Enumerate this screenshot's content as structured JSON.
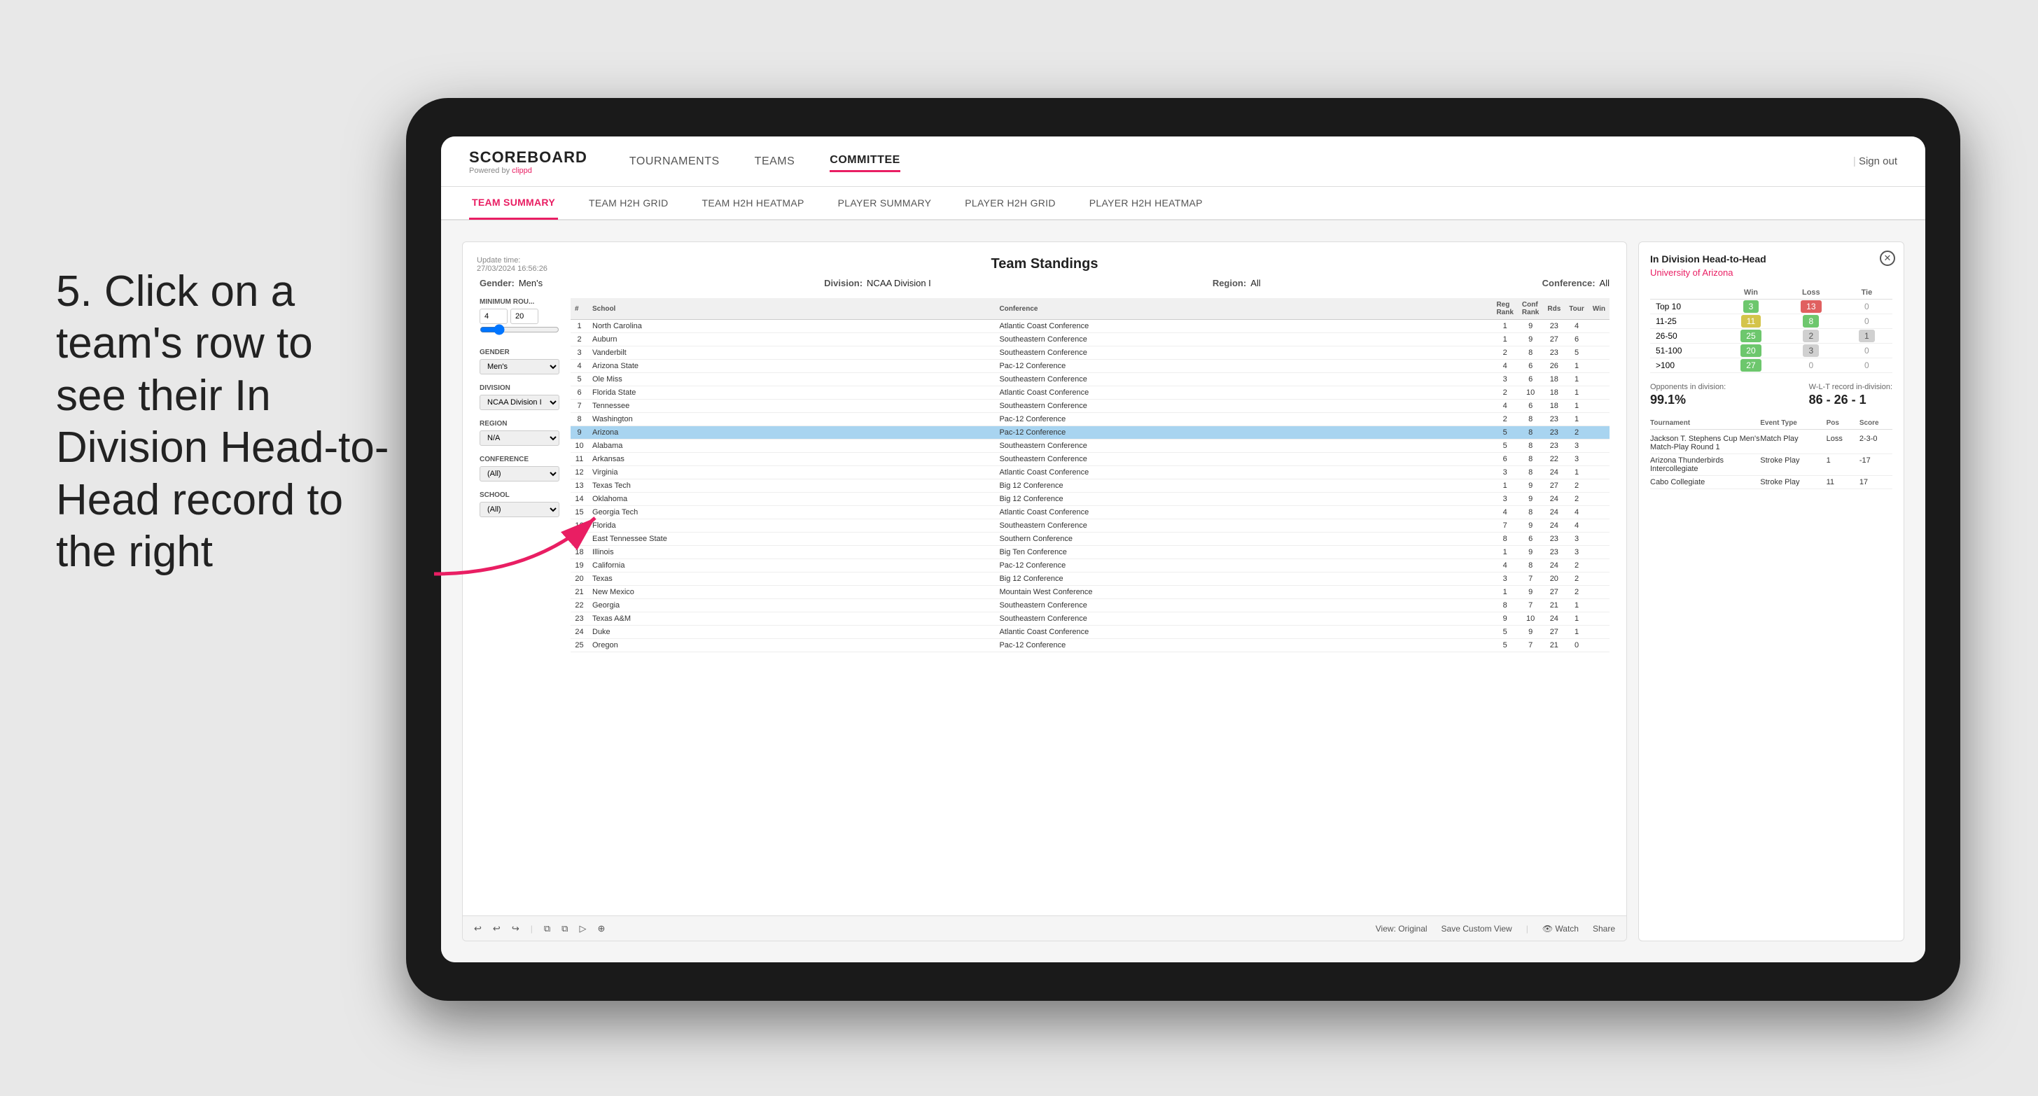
{
  "page": {
    "background": "#e8e8e8"
  },
  "instruction": {
    "text": "5. Click on a team's row to see their In Division Head-to-Head record to the right"
  },
  "header": {
    "logo": "SCOREBOARD",
    "logo_sub": "Powered by",
    "logo_brand": "clippd",
    "nav_items": [
      "TOURNAMENTS",
      "TEAMS",
      "COMMITTEE"
    ],
    "active_nav": "COMMITTEE",
    "sign_out": "Sign out"
  },
  "sub_nav": {
    "items": [
      "TEAM SUMMARY",
      "TEAM H2H GRID",
      "TEAM H2H HEATMAP",
      "PLAYER SUMMARY",
      "PLAYER H2H GRID",
      "PLAYER H2H HEATMAP"
    ],
    "active": "PLAYER SUMMARY"
  },
  "panel": {
    "update_time": "Update time:",
    "update_date": "27/03/2024 16:56:26",
    "title": "Team Standings",
    "gender_label": "Gender:",
    "gender_value": "Men's",
    "division_label": "Division:",
    "division_value": "NCAA Division I",
    "region_label": "Region:",
    "region_value": "All",
    "conference_label": "Conference:",
    "conference_value": "All"
  },
  "left_controls": {
    "min_rounds_label": "Minimum Rou...",
    "min_rounds_value": "4",
    "min_rounds_max": "20",
    "gender_label": "Gender",
    "gender_value": "Men's",
    "division_label": "Division",
    "division_value": "NCAA Division I",
    "region_label": "Region",
    "region_value": "N/A",
    "conference_label": "Conference",
    "conference_value": "(All)",
    "school_label": "School",
    "school_value": "(All)"
  },
  "table": {
    "headers": [
      "#",
      "School",
      "Conference",
      "Reg Rank",
      "Conf Rank",
      "Rds",
      "Tour",
      "Win"
    ],
    "rows": [
      {
        "rank": 1,
        "school": "North Carolina",
        "conference": "Atlantic Coast Conference",
        "reg_rank": 1,
        "conf_rank": 9,
        "rds": 23,
        "tour": 4,
        "highlighted": false
      },
      {
        "rank": 2,
        "school": "Auburn",
        "conference": "Southeastern Conference",
        "reg_rank": 1,
        "conf_rank": 9,
        "rds": 27,
        "tour": 6,
        "highlighted": false
      },
      {
        "rank": 3,
        "school": "Vanderbilt",
        "conference": "Southeastern Conference",
        "reg_rank": 2,
        "conf_rank": 8,
        "rds": 23,
        "tour": 5,
        "highlighted": false
      },
      {
        "rank": 4,
        "school": "Arizona State",
        "conference": "Pac-12 Conference",
        "reg_rank": 4,
        "conf_rank": 6,
        "rds": 26,
        "tour": 1,
        "highlighted": false
      },
      {
        "rank": 5,
        "school": "Ole Miss",
        "conference": "Southeastern Conference",
        "reg_rank": 3,
        "conf_rank": 6,
        "rds": 18,
        "tour": 1,
        "highlighted": false
      },
      {
        "rank": 6,
        "school": "Florida State",
        "conference": "Atlantic Coast Conference",
        "reg_rank": 2,
        "conf_rank": 10,
        "rds": 18,
        "tour": 1,
        "highlighted": false
      },
      {
        "rank": 7,
        "school": "Tennessee",
        "conference": "Southeastern Conference",
        "reg_rank": 4,
        "conf_rank": 6,
        "rds": 18,
        "tour": 1,
        "highlighted": false
      },
      {
        "rank": 8,
        "school": "Washington",
        "conference": "Pac-12 Conference",
        "reg_rank": 2,
        "conf_rank": 8,
        "rds": 23,
        "tour": 1,
        "highlighted": false
      },
      {
        "rank": 9,
        "school": "Arizona",
        "conference": "Pac-12 Conference",
        "reg_rank": 5,
        "conf_rank": 8,
        "rds": 23,
        "tour": 2,
        "highlighted": true
      },
      {
        "rank": 10,
        "school": "Alabama",
        "conference": "Southeastern Conference",
        "reg_rank": 5,
        "conf_rank": 8,
        "rds": 23,
        "tour": 3,
        "highlighted": false
      },
      {
        "rank": 11,
        "school": "Arkansas",
        "conference": "Southeastern Conference",
        "reg_rank": 6,
        "conf_rank": 8,
        "rds": 22,
        "tour": 3,
        "highlighted": false
      },
      {
        "rank": 12,
        "school": "Virginia",
        "conference": "Atlantic Coast Conference",
        "reg_rank": 3,
        "conf_rank": 8,
        "rds": 24,
        "tour": 1,
        "highlighted": false
      },
      {
        "rank": 13,
        "school": "Texas Tech",
        "conference": "Big 12 Conference",
        "reg_rank": 1,
        "conf_rank": 9,
        "rds": 27,
        "tour": 2,
        "highlighted": false
      },
      {
        "rank": 14,
        "school": "Oklahoma",
        "conference": "Big 12 Conference",
        "reg_rank": 3,
        "conf_rank": 9,
        "rds": 24,
        "tour": 2,
        "highlighted": false
      },
      {
        "rank": 15,
        "school": "Georgia Tech",
        "conference": "Atlantic Coast Conference",
        "reg_rank": 4,
        "conf_rank": 8,
        "rds": 24,
        "tour": 4,
        "highlighted": false
      },
      {
        "rank": 16,
        "school": "Florida",
        "conference": "Southeastern Conference",
        "reg_rank": 7,
        "conf_rank": 9,
        "rds": 24,
        "tour": 4,
        "highlighted": false
      },
      {
        "rank": 17,
        "school": "East Tennessee State",
        "conference": "Southern Conference",
        "reg_rank": 8,
        "conf_rank": 6,
        "rds": 23,
        "tour": 3,
        "highlighted": false
      },
      {
        "rank": 18,
        "school": "Illinois",
        "conference": "Big Ten Conference",
        "reg_rank": 1,
        "conf_rank": 9,
        "rds": 23,
        "tour": 3,
        "highlighted": false
      },
      {
        "rank": 19,
        "school": "California",
        "conference": "Pac-12 Conference",
        "reg_rank": 4,
        "conf_rank": 8,
        "rds": 24,
        "tour": 2,
        "highlighted": false
      },
      {
        "rank": 20,
        "school": "Texas",
        "conference": "Big 12 Conference",
        "reg_rank": 3,
        "conf_rank": 7,
        "rds": 20,
        "tour": 2,
        "highlighted": false
      },
      {
        "rank": 21,
        "school": "New Mexico",
        "conference": "Mountain West Conference",
        "reg_rank": 1,
        "conf_rank": 9,
        "rds": 27,
        "tour": 2,
        "highlighted": false
      },
      {
        "rank": 22,
        "school": "Georgia",
        "conference": "Southeastern Conference",
        "reg_rank": 8,
        "conf_rank": 7,
        "rds": 21,
        "tour": 1,
        "highlighted": false
      },
      {
        "rank": 23,
        "school": "Texas A&M",
        "conference": "Southeastern Conference",
        "reg_rank": 9,
        "conf_rank": 10,
        "rds": 24,
        "tour": 1,
        "highlighted": false
      },
      {
        "rank": 24,
        "school": "Duke",
        "conference": "Atlantic Coast Conference",
        "reg_rank": 5,
        "conf_rank": 9,
        "rds": 27,
        "tour": 1,
        "highlighted": false
      },
      {
        "rank": 25,
        "school": "Oregon",
        "conference": "Pac-12 Conference",
        "reg_rank": 5,
        "conf_rank": 7,
        "rds": 21,
        "tour": 0,
        "highlighted": false
      }
    ]
  },
  "h2h_panel": {
    "title": "In Division Head-to-Head",
    "school": "University of Arizona",
    "win_label": "Win",
    "loss_label": "Loss",
    "tie_label": "Tie",
    "rows": [
      {
        "label": "Top 10",
        "win": 3,
        "loss": 13,
        "tie": 0,
        "win_color": "green",
        "loss_color": "red",
        "tie_color": "zero"
      },
      {
        "label": "11-25",
        "win": 11,
        "loss": 8,
        "tie": 0,
        "win_color": "yellow",
        "loss_color": "green",
        "tie_color": "zero"
      },
      {
        "label": "26-50",
        "win": 25,
        "loss": 2,
        "tie": 1,
        "win_color": "green",
        "loss_color": "gray",
        "tie_color": "gray"
      },
      {
        "label": "51-100",
        "win": 20,
        "loss": 3,
        "tie": 0,
        "win_color": "green",
        "loss_color": "gray",
        "tie_color": "zero"
      },
      {
        "label": ">100",
        "win": 27,
        "loss": 0,
        "tie": 0,
        "win_color": "green",
        "loss_color": "zero",
        "tie_color": "zero"
      }
    ],
    "opponents_label": "Opponents in division:",
    "opponents_value": "99.1%",
    "wlt_label": "W-L-T record in-division:",
    "wlt_value": "86 - 26 - 1",
    "tournament_headers": [
      "Tournament",
      "Event Type",
      "Pos",
      "Score"
    ],
    "tournaments": [
      {
        "name": "Jackson T. Stephens Cup Men's Match-Play Round 1",
        "type": "Match Play",
        "pos": "Loss",
        "score": "2-3-0"
      },
      {
        "name": "Arizona Thunderbirds Intercollegiate",
        "type": "Stroke Play",
        "pos": "1",
        "score": "-17"
      },
      {
        "name": "Cabo Collegiate",
        "type": "Stroke Play",
        "pos": "11",
        "score": "17"
      }
    ]
  },
  "toolbar": {
    "buttons": [
      "↩",
      "↩",
      "↪",
      "⧉",
      "⧉",
      "▷",
      "⊕"
    ],
    "view_original": "View: Original",
    "save_custom": "Save Custom View",
    "watch": "Watch",
    "share": "Share"
  }
}
